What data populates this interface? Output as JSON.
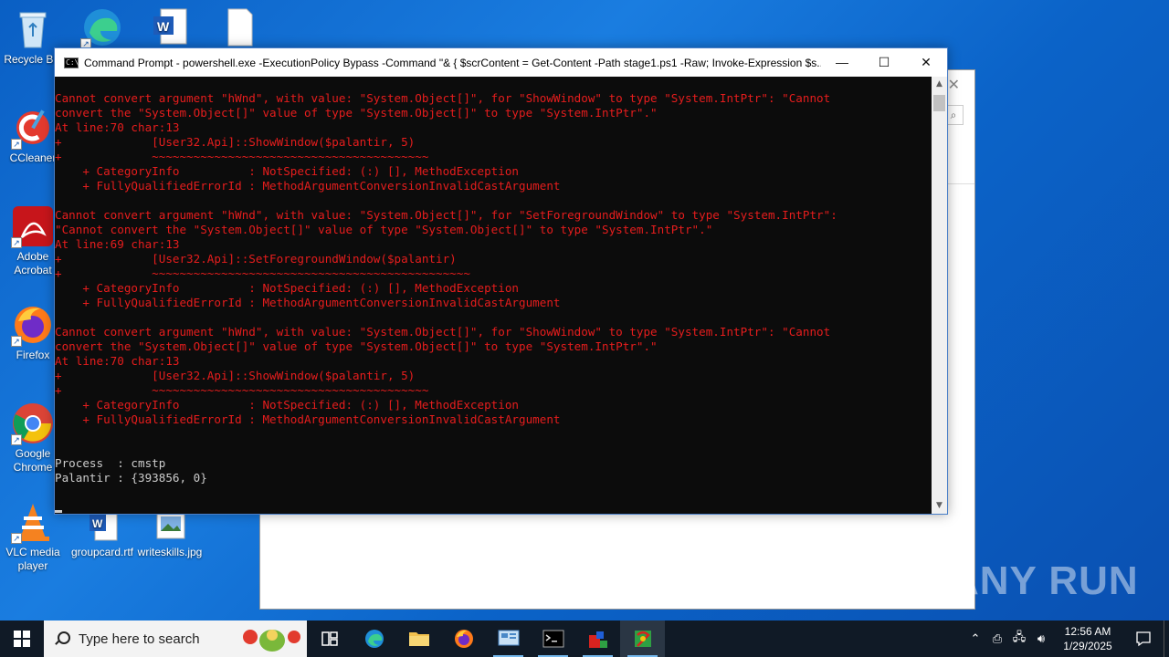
{
  "desktop": {
    "icons": [
      {
        "label": "Recycle Bin"
      },
      {
        "label": "CCleaner"
      },
      {
        "label": "Adobe Acrobat"
      },
      {
        "label": "Firefox"
      },
      {
        "label": "Google Chrome"
      },
      {
        "label": "VLC media player"
      },
      {
        "label": "groupcard.rtf"
      },
      {
        "label": "writeskills.jpg"
      }
    ]
  },
  "console": {
    "title": "Command Prompt - powershell.exe  -ExecutionPolicy Bypass -Command \"& { $scrContent = Get-Content -Path stage1.ps1 -Raw; Invoke-Expression $s...",
    "minimize_symbol": "—",
    "maximize_symbol": "☐",
    "close_symbol": "✕",
    "lines": [
      {
        "t": "Cannot convert argument \"hWnd\", with value: \"System.Object[]\", for \"ShowWindow\" to type \"System.IntPtr\": \"Cannot",
        "c": "err"
      },
      {
        "t": "convert the \"System.Object[]\" value of type \"System.Object[]\" to type \"System.IntPtr\".\"",
        "c": "err"
      },
      {
        "t": "At line:70 char:13",
        "c": "err"
      },
      {
        "t": "+             [User32.Api]::ShowWindow($palantir, 5)",
        "c": "err"
      },
      {
        "t": "+             ~~~~~~~~~~~~~~~~~~~~~~~~~~~~~~~~~~~~~~~~",
        "c": "err"
      },
      {
        "t": "    + CategoryInfo          : NotSpecified: (:) [], MethodException",
        "c": "err"
      },
      {
        "t": "    + FullyQualifiedErrorId : MethodArgumentConversionInvalidCastArgument",
        "c": "err"
      },
      {
        "t": "",
        "c": "err"
      },
      {
        "t": "Cannot convert argument \"hWnd\", with value: \"System.Object[]\", for \"SetForegroundWindow\" to type \"System.IntPtr\":",
        "c": "err"
      },
      {
        "t": "\"Cannot convert the \"System.Object[]\" value of type \"System.Object[]\" to type \"System.IntPtr\".\"",
        "c": "err"
      },
      {
        "t": "At line:69 char:13",
        "c": "err"
      },
      {
        "t": "+             [User32.Api]::SetForegroundWindow($palantir)",
        "c": "err"
      },
      {
        "t": "+             ~~~~~~~~~~~~~~~~~~~~~~~~~~~~~~~~~~~~~~~~~~~~~~",
        "c": "err"
      },
      {
        "t": "    + CategoryInfo          : NotSpecified: (:) [], MethodException",
        "c": "err"
      },
      {
        "t": "    + FullyQualifiedErrorId : MethodArgumentConversionInvalidCastArgument",
        "c": "err"
      },
      {
        "t": "",
        "c": "err"
      },
      {
        "t": "Cannot convert argument \"hWnd\", with value: \"System.Object[]\", for \"ShowWindow\" to type \"System.IntPtr\": \"Cannot",
        "c": "err"
      },
      {
        "t": "convert the \"System.Object[]\" value of type \"System.Object[]\" to type \"System.IntPtr\".\"",
        "c": "err"
      },
      {
        "t": "At line:70 char:13",
        "c": "err"
      },
      {
        "t": "+             [User32.Api]::ShowWindow($palantir, 5)",
        "c": "err"
      },
      {
        "t": "+             ~~~~~~~~~~~~~~~~~~~~~~~~~~~~~~~~~~~~~~~~",
        "c": "err"
      },
      {
        "t": "    + CategoryInfo          : NotSpecified: (:) [], MethodException",
        "c": "err"
      },
      {
        "t": "    + FullyQualifiedErrorId : MethodArgumentConversionInvalidCastArgument",
        "c": "err"
      },
      {
        "t": "",
        "c": "norm"
      },
      {
        "t": "",
        "c": "norm"
      },
      {
        "t": "Process  : cmstp",
        "c": "norm"
      },
      {
        "t": "Palantir : {393856, 0}",
        "c": "norm"
      },
      {
        "t": "",
        "c": "norm"
      }
    ]
  },
  "taskbar": {
    "search_placeholder": "Type here to search",
    "clock_time": "12:56 AM",
    "clock_date": "1/29/2025"
  },
  "watermark": "ANY RUN",
  "colors": {
    "error_text": "#e61d1d",
    "normal_text": "#cccccc",
    "taskbar_bg": "#101a26",
    "accent": "#76b9ed"
  }
}
